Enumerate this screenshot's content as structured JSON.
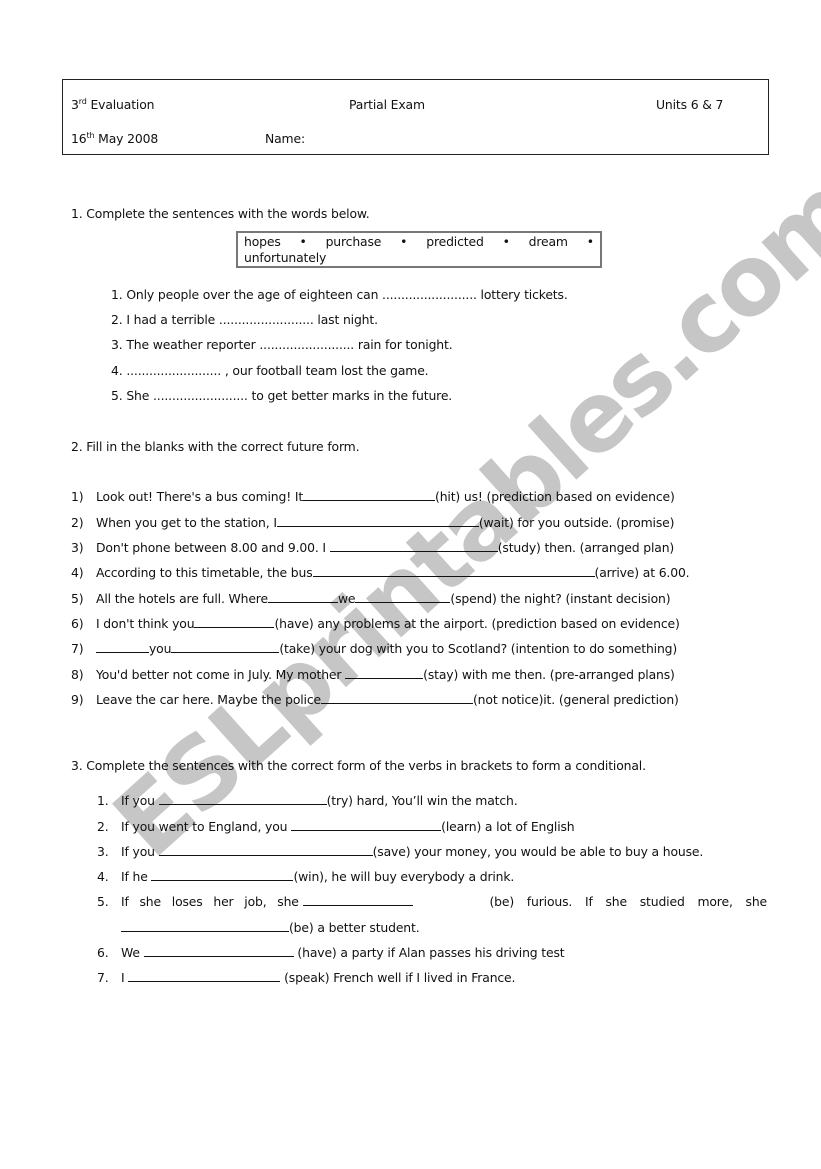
{
  "header": {
    "evaluation_num": "3",
    "evaluation_sup": "rd",
    "evaluation_label": " Evaluation",
    "exam_type": "Partial Exam",
    "units": "Units 6 & 7",
    "date_day": "16",
    "date_sup": "th",
    "date_rest": " May 2008",
    "name_label": "Name:"
  },
  "watermark": "ESLprintables.com",
  "section1": {
    "title": "1. Complete the sentences with the words below.",
    "word_bank": [
      "hopes",
      "purchase",
      "predicted",
      "dream",
      "unfortunately"
    ],
    "bullet": "•",
    "items": [
      {
        "num": "1.",
        "text": "Only people over the age of eighteen can ......................... lottery tickets."
      },
      {
        "num": "2.",
        "text": "I had a terrible ......................... last night."
      },
      {
        "num": "3.",
        "text": "The weather reporter ......................... rain for tonight."
      },
      {
        "num": "4.",
        "text": "......................... , our football team lost the game."
      },
      {
        "num": "5.",
        "text": "She ......................... to get better marks in the future."
      }
    ]
  },
  "section2": {
    "title": "2. Fill in the blanks with the correct future form.",
    "items": [
      {
        "num": "1)",
        "before": "Look out! There's a bus coming! It",
        "after": "(hit) us! (prediction based on evidence)"
      },
      {
        "num": "2)",
        "before": "When you get to the station, I",
        "after": "(wait) for you outside. (promise)"
      },
      {
        "num": "3)",
        "before": "Don't phone between 8.00 and 9.00. I ",
        "after": "(study) then. (arranged plan)"
      },
      {
        "num": "4)",
        "before": "According to this timetable, the bus",
        "after": "(arrive) at 6.00."
      },
      {
        "num": "5)",
        "before": "All the hotels are full. Where",
        "middle": "we",
        "after": "(spend) the night? (instant decision)"
      },
      {
        "num": "6)",
        "before": "I don't think you",
        "after": "(have) any problems at the airport. (prediction based on evidence)"
      },
      {
        "num": "7)",
        "before": "",
        "middle": "you",
        "after": "(take) your dog with you to Scotland? (intention to do something)"
      },
      {
        "num": "8)",
        "before": "You'd better not come in July. My mother ",
        "after": "(stay) with me then. (pre-arranged plans)"
      },
      {
        "num": "9)",
        "before": "Leave the car here. Maybe the police",
        "after": "(not notice)it. (general prediction)"
      }
    ]
  },
  "section3": {
    "title": "3. Complete the sentences with the correct form of the verbs in brackets to form a conditional.",
    "items": [
      {
        "num": "1.",
        "before": "If you ",
        "after": "(try) hard, You’ll win the match."
      },
      {
        "num": "2.",
        "before": "If you went to England, you ",
        "after": "(learn) a lot of English"
      },
      {
        "num": "3.",
        "before": "If you ",
        "after": "(save) your money, you would be able to buy a house."
      },
      {
        "num": "4.",
        "before": "If he ",
        "after": "(win), he will buy everybody a drink."
      },
      {
        "num": "5.",
        "before": "If she loses her job, she ",
        "after": " (be) furious. If she studied more, she",
        "line2_after": "(be) a better student."
      },
      {
        "num": "6.",
        "before": "We ",
        "after": " (have) a party if Alan passes his driving test"
      },
      {
        "num": "7.",
        "before": "I ",
        "after": " (speak) French well if I lived in France."
      }
    ]
  }
}
